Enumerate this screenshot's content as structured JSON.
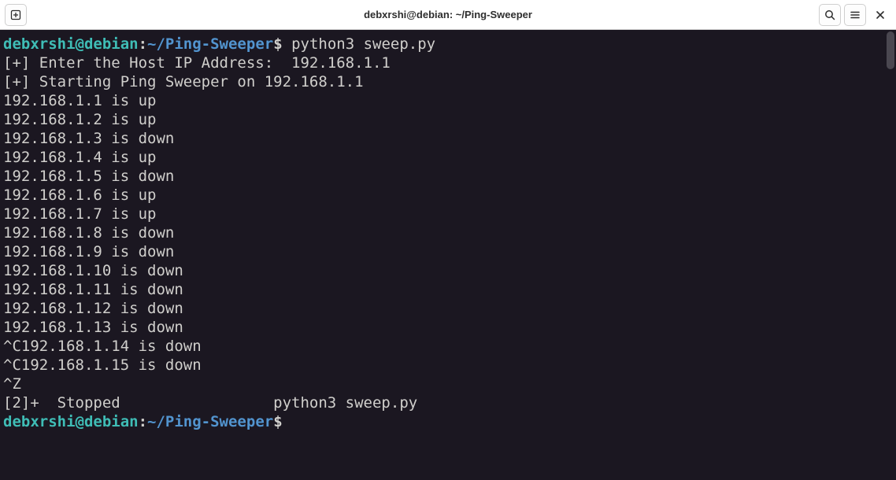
{
  "titlebar": {
    "title": "debxrshi@debian: ~/Ping-Sweeper"
  },
  "prompt1": {
    "user": "debxrshi@debian",
    "colon": ":",
    "path": "~/Ping-Sweeper",
    "dollar": "$",
    "cmd": " python3 sweep.py"
  },
  "input_prompt": "[+] Enter the Host IP Address:  192.168.1.1",
  "start_line": "[+] Starting Ping Sweeper on 192.168.1.1",
  "blank": "",
  "results": [
    "192.168.1.1 is up",
    "192.168.1.2 is up",
    "192.168.1.3 is down",
    "192.168.1.4 is up",
    "192.168.1.5 is down",
    "192.168.1.6 is up",
    "192.168.1.7 is up",
    "192.168.1.8 is down",
    "192.168.1.9 is down",
    "192.168.1.10 is down",
    "192.168.1.11 is down",
    "192.168.1.12 is down",
    "192.168.1.13 is down",
    "^C192.168.1.14 is down",
    "^C192.168.1.15 is down"
  ],
  "ctrlz": "^Z",
  "stopped": "[2]+  Stopped                 python3 sweep.py",
  "prompt2": {
    "user": "debxrshi@debian",
    "colon": ":",
    "path": "~/Ping-Sweeper",
    "dollar": "$",
    "cmd": " "
  }
}
